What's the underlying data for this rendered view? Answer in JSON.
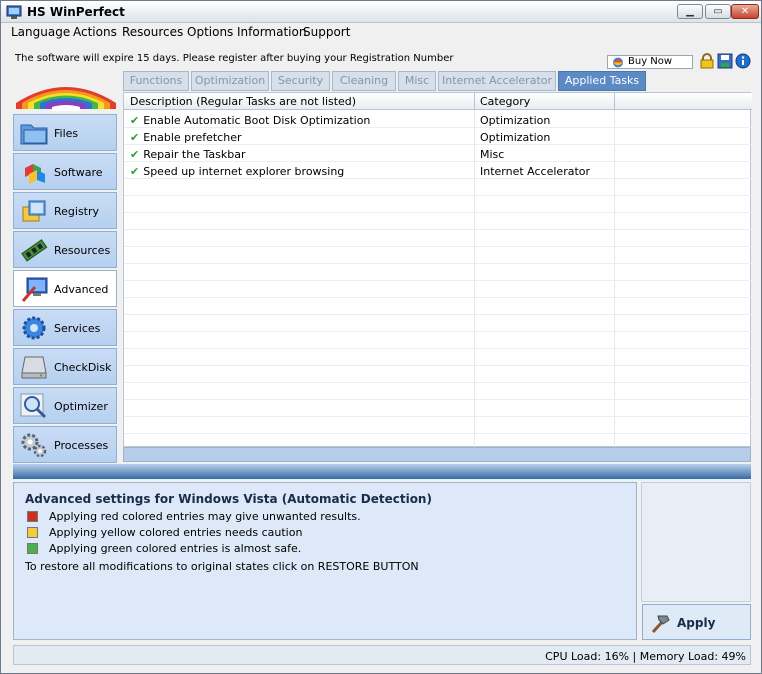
{
  "window": {
    "title": "HS WinPerfect"
  },
  "menu": [
    "Language",
    "Actions",
    "Resources",
    "Options",
    "Information",
    "Support"
  ],
  "notice": "The software will expire 15 days. Please register after buying your Registration Number",
  "buy_now": "Buy Now",
  "nav": [
    {
      "label": "Files",
      "icon": "folder-icon"
    },
    {
      "label": "Software",
      "icon": "software-icon"
    },
    {
      "label": "Registry",
      "icon": "registry-icon"
    },
    {
      "label": "Resources",
      "icon": "memory-icon"
    },
    {
      "label": "Advanced",
      "icon": "advanced-icon",
      "active": true
    },
    {
      "label": "Services",
      "icon": "services-icon"
    },
    {
      "label": "CheckDisk",
      "icon": "disk-icon"
    },
    {
      "label": "Optimizer",
      "icon": "magnifier-icon"
    },
    {
      "label": "Processes",
      "icon": "gears-icon"
    }
  ],
  "tabs": [
    "Functions",
    "Optimization",
    "Security",
    "Cleaning",
    "Misc",
    "Internet Accelerator",
    "Applied Tasks"
  ],
  "active_tab": "Applied Tasks",
  "table": {
    "headers": [
      "Description (Regular Tasks are not listed)",
      "Category"
    ],
    "rows": [
      {
        "desc": "Enable Automatic Boot Disk Optimization",
        "cat": "Optimization"
      },
      {
        "desc": "Enable prefetcher",
        "cat": "Optimization"
      },
      {
        "desc": "Repair the Taskbar",
        "cat": "Misc"
      },
      {
        "desc": "Speed up internet explorer browsing",
        "cat": "Internet Accelerator"
      }
    ]
  },
  "info": {
    "title": "Advanced settings for  Windows Vista (Automatic Detection)",
    "legend": [
      {
        "text": "Applying red colored entries may give unwanted results.",
        "color": "#c8321e"
      },
      {
        "text": "Applying yellow colored entries needs caution",
        "color": "#f2cc3a"
      },
      {
        "text": "Applying green colored entries is almost safe.",
        "color": "#4caf50"
      }
    ],
    "restore": "To restore all modifications to original states click on RESTORE BUTTON"
  },
  "apply": "Apply",
  "status": "CPU Load: 16%  |  Memory Load: 49%"
}
